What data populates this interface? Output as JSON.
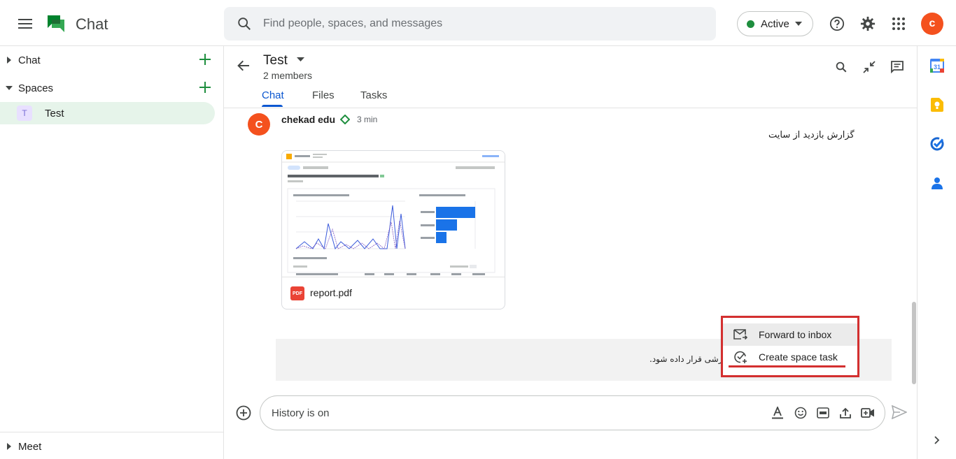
{
  "app": {
    "title": "Chat"
  },
  "search": {
    "placeholder": "Find people, spaces, and messages"
  },
  "status": {
    "label": "Active",
    "color": "#1e8e3e"
  },
  "user": {
    "avatar_letter": "c",
    "avatar_color": "#f4511e"
  },
  "sidebar": {
    "chat_label": "Chat",
    "spaces_label": "Spaces",
    "space_item": {
      "initial": "T",
      "label": "Test"
    },
    "meet_label": "Meet"
  },
  "space": {
    "title": "Test",
    "members": "2 members",
    "tabs": [
      "Chat",
      "Files",
      "Tasks"
    ]
  },
  "message": {
    "avatar_letter": "C",
    "sender": "chekad edu",
    "time": "3 min",
    "text": "گزارش بازدید از سایت",
    "attachment": {
      "type_label": "PDF",
      "name": "report.pdf"
    },
    "second_text": "موزشی قرار داده شود."
  },
  "context_menu": {
    "items": [
      "Forward to inbox",
      "Create space task"
    ]
  },
  "compose": {
    "placeholder": "History is on"
  },
  "colors": {
    "accent": "#0b57d0",
    "highlight": "#d32f2f",
    "brand_green": "#34a853"
  }
}
